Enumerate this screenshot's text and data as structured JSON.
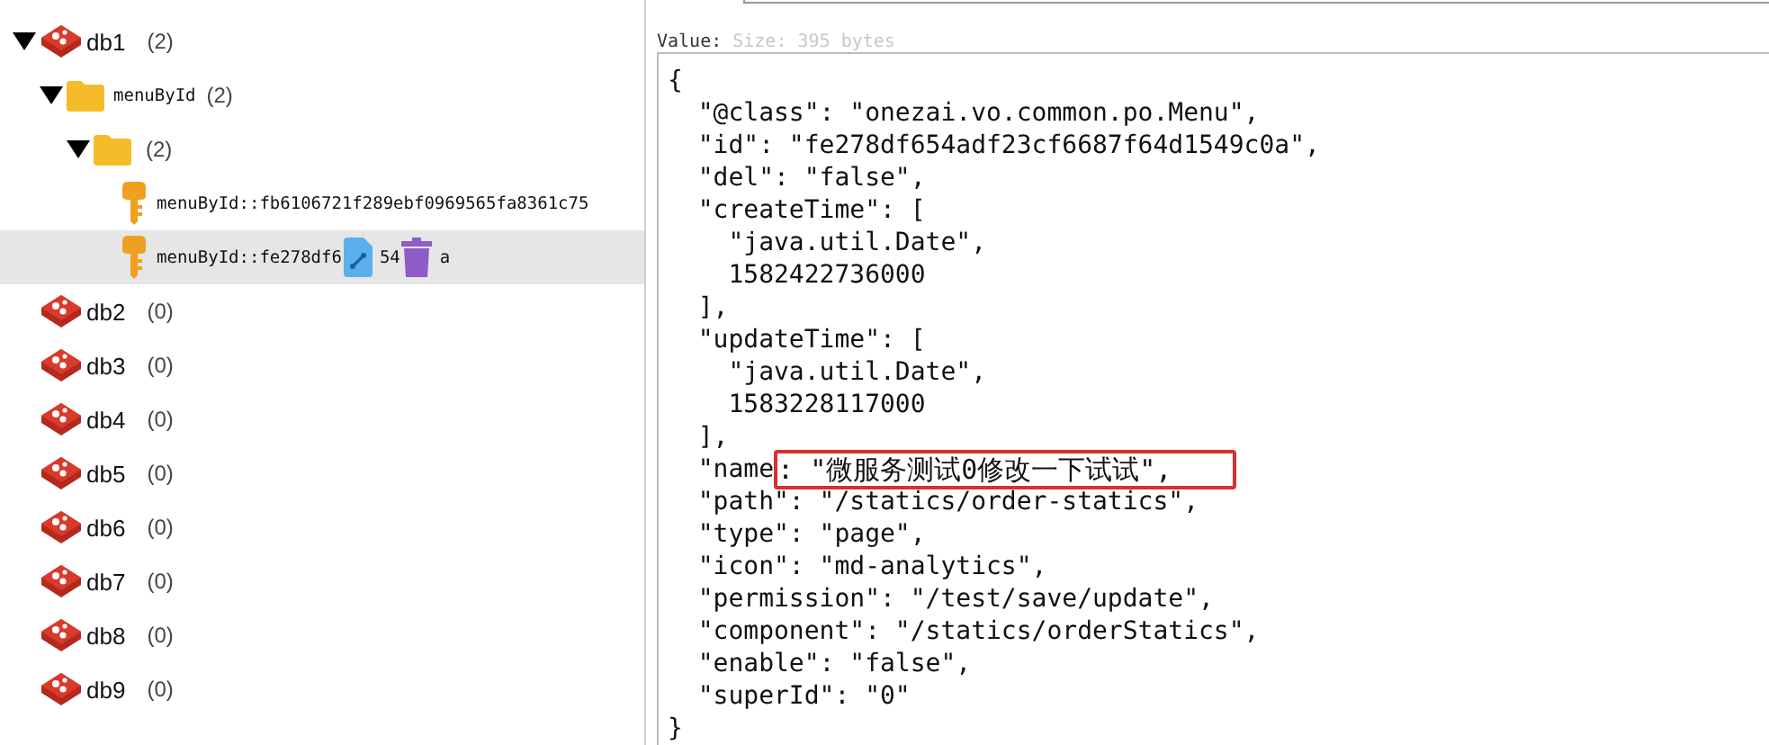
{
  "tree": [
    {
      "kind": "db",
      "label": "db1",
      "count": "(2)",
      "expanded": true,
      "selected": false,
      "children": [
        {
          "kind": "folder",
          "label": "menuById",
          "count": "(2)",
          "expanded": true,
          "selected": false,
          "children": [
            {
              "kind": "folder",
              "count": "(2)",
              "expanded": true,
              "selected": false,
              "children": [
                {
                  "kind": "key",
                  "label": "menuById::fb6106721f289ebf0969565fa8361c75",
                  "selected": false,
                  "hover_actions": false
                },
                {
                  "kind": "key",
                  "label": "menuById::fe278df6",
                  "label_tail": "54",
                  "label_end": "a",
                  "selected": true,
                  "hover_actions": true
                }
              ]
            }
          ]
        }
      ]
    },
    {
      "kind": "db",
      "label": "db2",
      "count": "(0)",
      "selected": false
    },
    {
      "kind": "db",
      "label": "db3",
      "count": "(0)",
      "selected": false
    },
    {
      "kind": "db",
      "label": "db4",
      "count": "(0)",
      "selected": false
    },
    {
      "kind": "db",
      "label": "db5",
      "count": "(0)",
      "selected": false
    },
    {
      "kind": "db",
      "label": "db6",
      "count": "(0)",
      "selected": false
    },
    {
      "kind": "db",
      "label": "db7",
      "count": "(0)",
      "selected": false
    },
    {
      "kind": "db",
      "label": "db8",
      "count": "(0)",
      "selected": false
    },
    {
      "kind": "db",
      "label": "db9",
      "count": "(0)",
      "selected": false
    }
  ],
  "value_panel": {
    "value_label": "Value:",
    "size_placeholder": "Size: 395 bytes",
    "lines": [
      {
        "text": "{"
      },
      {
        "text": "  \"@class\": \"onezai.vo.common.po.Menu\","
      },
      {
        "text": "  \"id\": \"fe278df654adf23cf6687f64d1549c0a\","
      },
      {
        "text": "  \"del\": \"false\","
      },
      {
        "text": "  \"createTime\": ["
      },
      {
        "text": "    \"java.util.Date\","
      },
      {
        "text": "    1582422736000"
      },
      {
        "text": "  ],"
      },
      {
        "text": "  \"updateTime\": ["
      },
      {
        "text": "    \"java.util.Date\","
      },
      {
        "text": "    1583228117000"
      },
      {
        "text": "  ],"
      },
      {
        "text": "  \"name",
        "highlight": ": \"微服务测试0修改一下试试\","
      },
      {
        "text": "  \"path\": \"/statics/order-statics\","
      },
      {
        "text": "  \"type\": \"page\","
      },
      {
        "text": "  \"icon\": \"md-analytics\","
      },
      {
        "text": "  \"permission\": \"/test/save/update\","
      },
      {
        "text": "  \"component\": \"/statics/orderStatics\","
      },
      {
        "text": "  \"enable\": \"false\","
      },
      {
        "text": "  \"superId\": \"0\""
      },
      {
        "text": "}"
      }
    ]
  }
}
